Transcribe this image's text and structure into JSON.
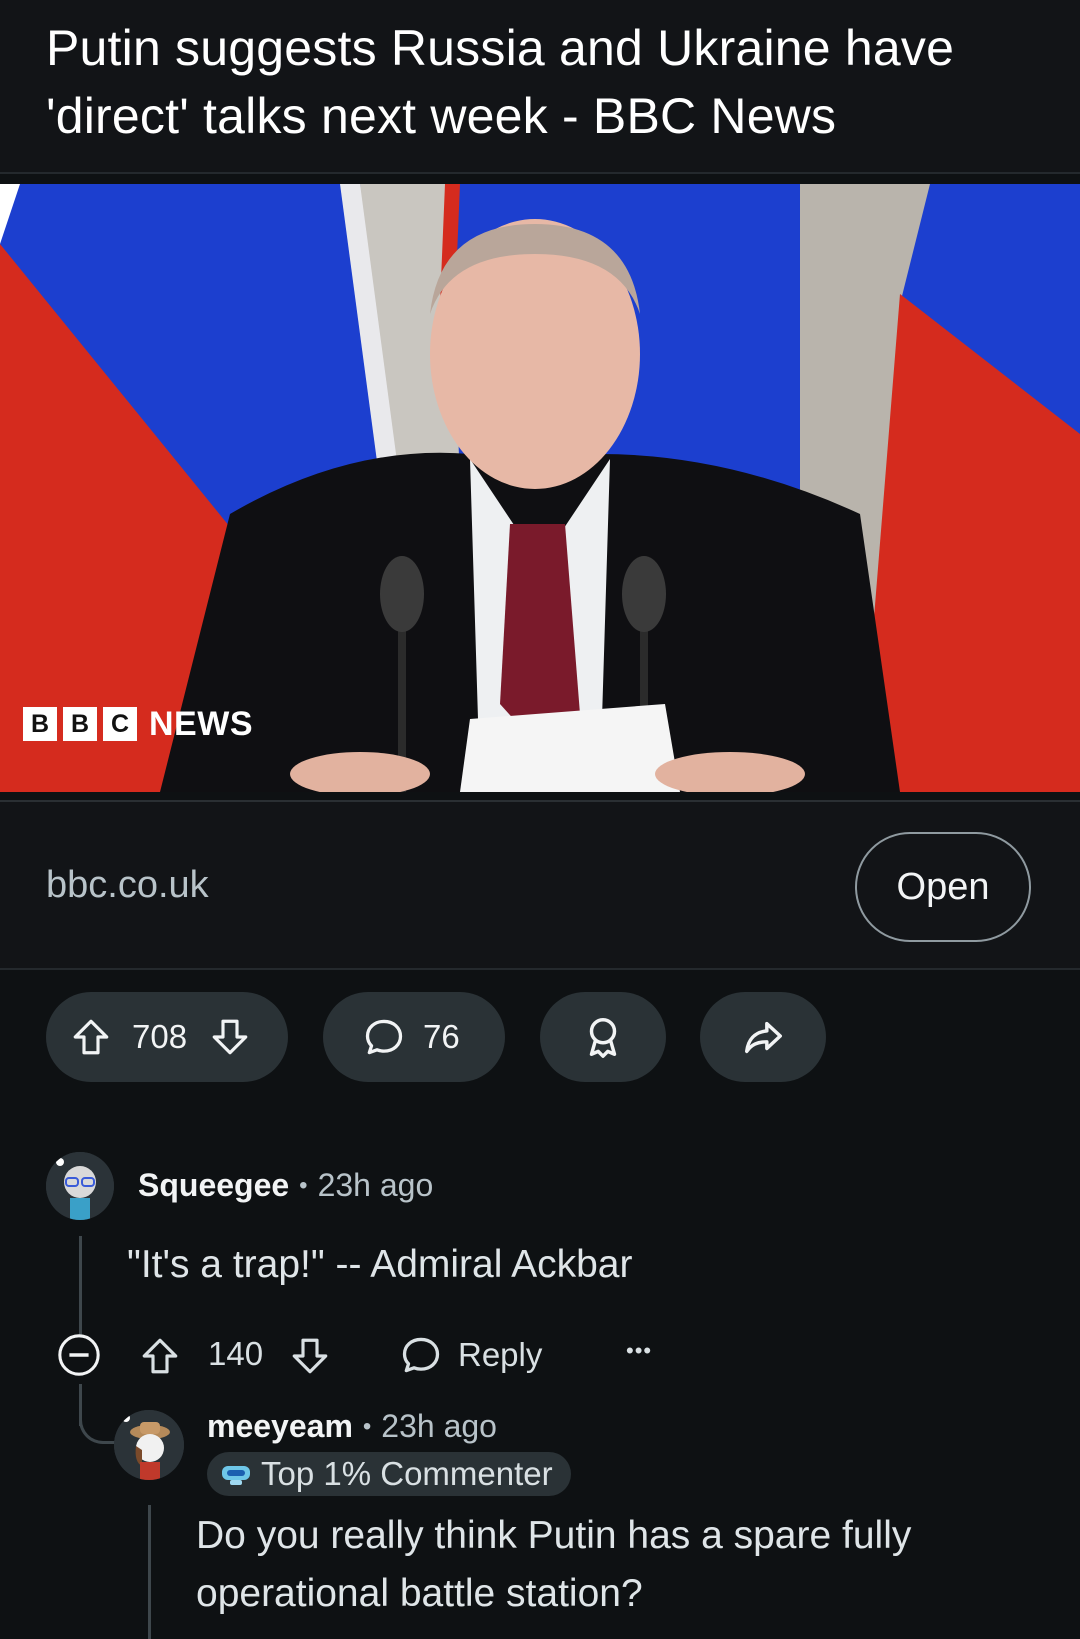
{
  "post": {
    "title": "Putin suggests Russia and Ukraine have 'direct' talks next week - BBC News",
    "domain": "bbc.co.uk",
    "open_label": "Open",
    "image_watermark": {
      "blocks": [
        "B",
        "B",
        "C"
      ],
      "news": "NEWS"
    },
    "votes": "708",
    "comments": "76"
  },
  "comments": [
    {
      "user": "Squeegee",
      "time": "23h ago",
      "text": "\"It's a trap!\" -- Admiral Ackbar",
      "votes": "140",
      "reply_label": "Reply",
      "more": "•••"
    },
    {
      "user": "meeyeam",
      "time": "23h ago",
      "badge": "Top 1% Commenter",
      "text": "Do you really think Putin has a spare fully operational battle station?"
    }
  ],
  "colors": {
    "background": "#0e1113",
    "pill": "#2a3236",
    "muted_text": "#b8c3c9",
    "flag_red": "#d52b1e",
    "flag_blue": "#1c3fcf"
  },
  "icons": [
    "upvote-icon",
    "downvote-icon",
    "comment-icon",
    "award-icon",
    "share-icon",
    "collapse-icon",
    "more-icon"
  ]
}
